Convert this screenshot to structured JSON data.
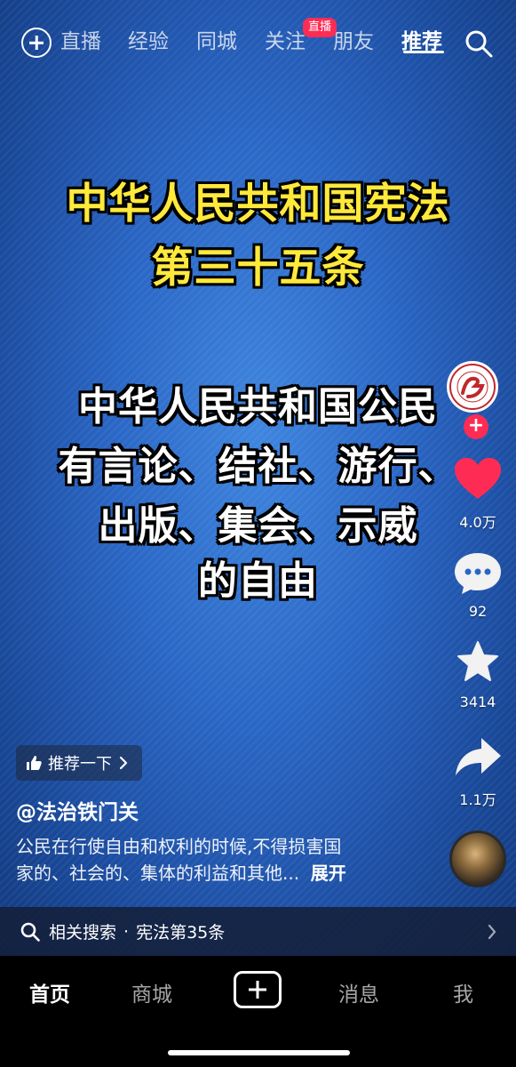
{
  "top_nav": {
    "tabs": [
      {
        "label": "直播"
      },
      {
        "label": "经验"
      },
      {
        "label": "同城"
      },
      {
        "label": "关注"
      },
      {
        "label": "朋友"
      },
      {
        "label": "推荐"
      }
    ],
    "active_tab": "推荐",
    "live_badge": "直播"
  },
  "video": {
    "title_lines": [
      "中华人民共和国宪法",
      "第三十五条"
    ],
    "body_lines": [
      "中华人民共和国公民",
      "有言论、结社、游行、",
      "出版、集会、示威",
      "的自由"
    ]
  },
  "rail": {
    "likes": "4.0万",
    "comments": "92",
    "favorites": "3414",
    "shares": "1.1万",
    "follow_symbol": "+"
  },
  "info": {
    "recommend_label": "推荐一下",
    "author": "@法治铁门关",
    "description_line1": "公民在行使自由和权利的时候,不得损害国",
    "description_line2": "家的、社会的、集体的利益和其他...",
    "expand_label": "展开"
  },
  "related_search": {
    "prefix": "相关搜索",
    "separator": "·",
    "query": "宪法第35条"
  },
  "bottom_tabs": {
    "home": "首页",
    "mall": "商城",
    "messages": "消息",
    "me": "我"
  },
  "colors": {
    "accent_red": "#fe2c55",
    "title_yellow": "#ffe93b",
    "video_blue": "#2a66c5"
  }
}
